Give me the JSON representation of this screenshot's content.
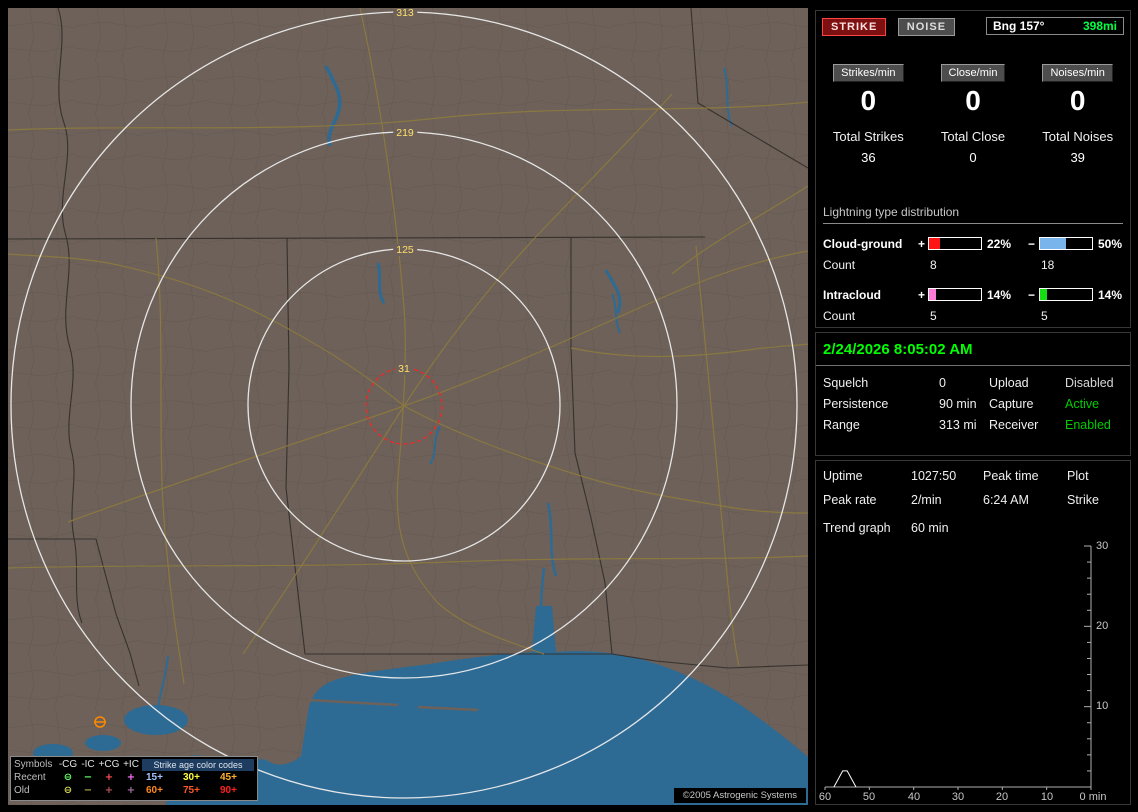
{
  "map": {
    "ring_labels": [
      "313",
      "219",
      "125",
      "31"
    ],
    "copyright": "©2005 Astrogenic Systems",
    "legend": {
      "symbols_header": "Symbols",
      "type_headers": [
        "-CG",
        "-IC",
        "+CG",
        "+IC"
      ],
      "age_header": "Strike age color codes",
      "recent_label": "Recent",
      "old_label": "Old",
      "symbol_glyphs": [
        "⊖",
        "−",
        "+",
        "+"
      ],
      "recent_symbol_colors": [
        "#64ff64",
        "#64ff64",
        "#ff5050",
        "#ff74ff"
      ],
      "old_symbol_colors": [
        "#d6d650",
        "#a8a848",
        "#b45454",
        "#a870a8"
      ],
      "recent_ages": [
        "15+",
        "30+",
        "45+"
      ],
      "old_ages": [
        "60+",
        "75+",
        "90+"
      ],
      "recent_age_colors": [
        "#9fc4ff",
        "#ffff40",
        "#ffb030"
      ],
      "old_age_colors": [
        "#ff8820",
        "#ff5828",
        "#ff2020"
      ]
    }
  },
  "sidebar": {
    "strike_button": "STRIKE",
    "noise_button": "NOISE",
    "bearing": {
      "label": "Bng 157°",
      "range": "398mi"
    },
    "rate_columns": [
      {
        "header": "Strikes/min",
        "rate": "0",
        "total_label": "Total Strikes",
        "total": "36"
      },
      {
        "header": "Close/min",
        "rate": "0",
        "total_label": "Total Close",
        "total": "0"
      },
      {
        "header": "Noises/min",
        "rate": "0",
        "total_label": "Total Noises",
        "total": "39"
      }
    ],
    "distribution": {
      "title": "Lightning type distribution",
      "plus_sign": "+",
      "minus_sign": "−",
      "count_label": "Count",
      "rows": [
        {
          "label": "Cloud-ground",
          "plus_pct": "22%",
          "minus_pct": "50%",
          "plus_fill": 22,
          "minus_fill": 50,
          "plus_count": "8",
          "minus_count": "18"
        },
        {
          "label": "Intracloud",
          "plus_pct": "14%",
          "minus_pct": "14%",
          "plus_fill": 14,
          "minus_fill": 14,
          "plus_count": "5",
          "minus_count": "5"
        }
      ]
    },
    "status": {
      "timestamp": "2/24/2026 8:05:02 AM",
      "rows": [
        {
          "l1": "Squelch",
          "v1": "0",
          "l2": "Upload",
          "v2": "Disabled",
          "v2_color": "#d8d8d8"
        },
        {
          "l1": "Persistence",
          "v1": "90 min",
          "l2": "Capture",
          "v2": "Active",
          "v2_color": "#00cc00"
        },
        {
          "l1": "Range",
          "v1": "313 mi",
          "l2": "Receiver",
          "v2": "Enabled",
          "v2_color": "#00cc00"
        }
      ]
    },
    "trend": {
      "uptime_label": "Uptime",
      "uptime": "1027:50",
      "peak_time_label": "Peak time",
      "plot_label": "Plot",
      "peak_rate_label": "Peak rate",
      "peak_rate": "2/min",
      "peak_time_value": "6:24 AM",
      "plot_value": "Strike",
      "graph_label": "Trend graph",
      "graph_window": "60 min"
    }
  },
  "chart_data": {
    "type": "line",
    "title": "Trend graph",
    "window_label": "60 min",
    "series_name": "Strike",
    "x_range_min": 60,
    "x_unit": "min",
    "ylim": [
      0,
      30
    ],
    "baseline": 0,
    "points": [
      [
        57,
        1
      ],
      [
        56,
        2
      ],
      [
        55,
        2
      ],
      [
        54,
        1
      ]
    ],
    "x_tick_labels": [
      "60",
      "50",
      "40",
      "30",
      "20",
      "10",
      "0 min"
    ],
    "y_tick_labels": [
      "30",
      "20",
      "10"
    ]
  },
  "colors": {
    "timestamp_green": "#00ff00",
    "bearing_green": "#00ff44",
    "bar_cg_plus": "#ff1414",
    "bar_cg_minus": "#7ab4ec",
    "bar_ic_plus": "#ff7ad6",
    "bar_ic_minus": "#14dd14"
  }
}
